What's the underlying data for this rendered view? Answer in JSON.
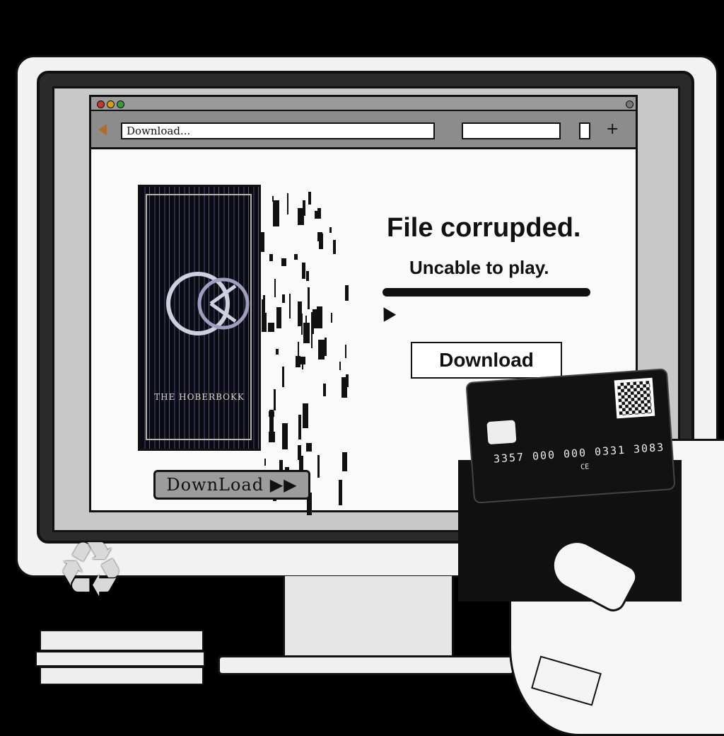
{
  "browser": {
    "address_bar": "Download...",
    "window_buttons": [
      "close",
      "minimize",
      "maximize"
    ]
  },
  "cover": {
    "title": "THE HOBERBOKK"
  },
  "left_download_button": {
    "label": "DownLoad ▶▶"
  },
  "error": {
    "title": "File corrupded.",
    "subtitle": "Uncable to play."
  },
  "main_download_button": {
    "label": "Download"
  },
  "card": {
    "number": "3357 000 000 0331 3083",
    "small_text": "CE"
  },
  "colors": {
    "background": "#000000",
    "bezel": "#f2f2f2",
    "card": "#121212",
    "dot_red": "#c0392b",
    "dot_yellow": "#d4a017",
    "dot_green": "#3a9a3a"
  },
  "icons": [
    "back-arrow-icon",
    "menu-icon",
    "plus-icon",
    "cursor-icon",
    "recycle-icon"
  ]
}
